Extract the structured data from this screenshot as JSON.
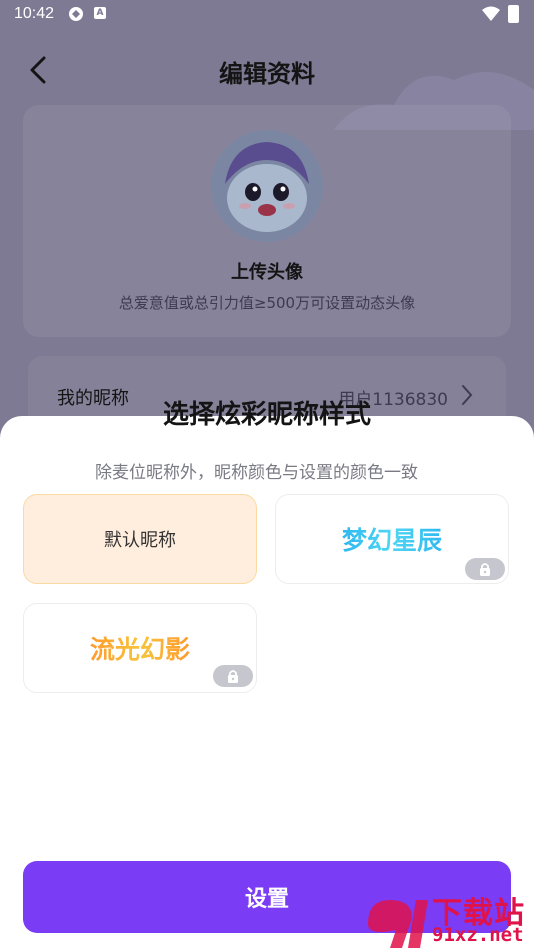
{
  "status_bar": {
    "time": "10:42",
    "badge_letter": "A"
  },
  "header": {
    "title": "编辑资料"
  },
  "avatar_section": {
    "upload_label": "上传头像",
    "hint": "总爱意值或总引力值≥500万可设置动态头像"
  },
  "nickname_row": {
    "label": "我的昵称",
    "value": "用户1136830"
  },
  "sheet": {
    "title": "选择炫彩昵称样式",
    "subtitle": "除麦位昵称外，昵称颜色与设置的颜色一致",
    "options": [
      {
        "label": "默认昵称",
        "selected": true,
        "locked": false
      },
      {
        "label": "梦幻星辰",
        "selected": false,
        "locked": true
      },
      {
        "label": "流光幻影",
        "selected": false,
        "locked": true
      }
    ],
    "set_button": "设置"
  },
  "watermark": {
    "text": "下载站",
    "url": "91xz.net"
  },
  "colors": {
    "accent": "#7a3cf5",
    "selected_bg": "#ffeedd",
    "overlay": "#7e7a93"
  }
}
